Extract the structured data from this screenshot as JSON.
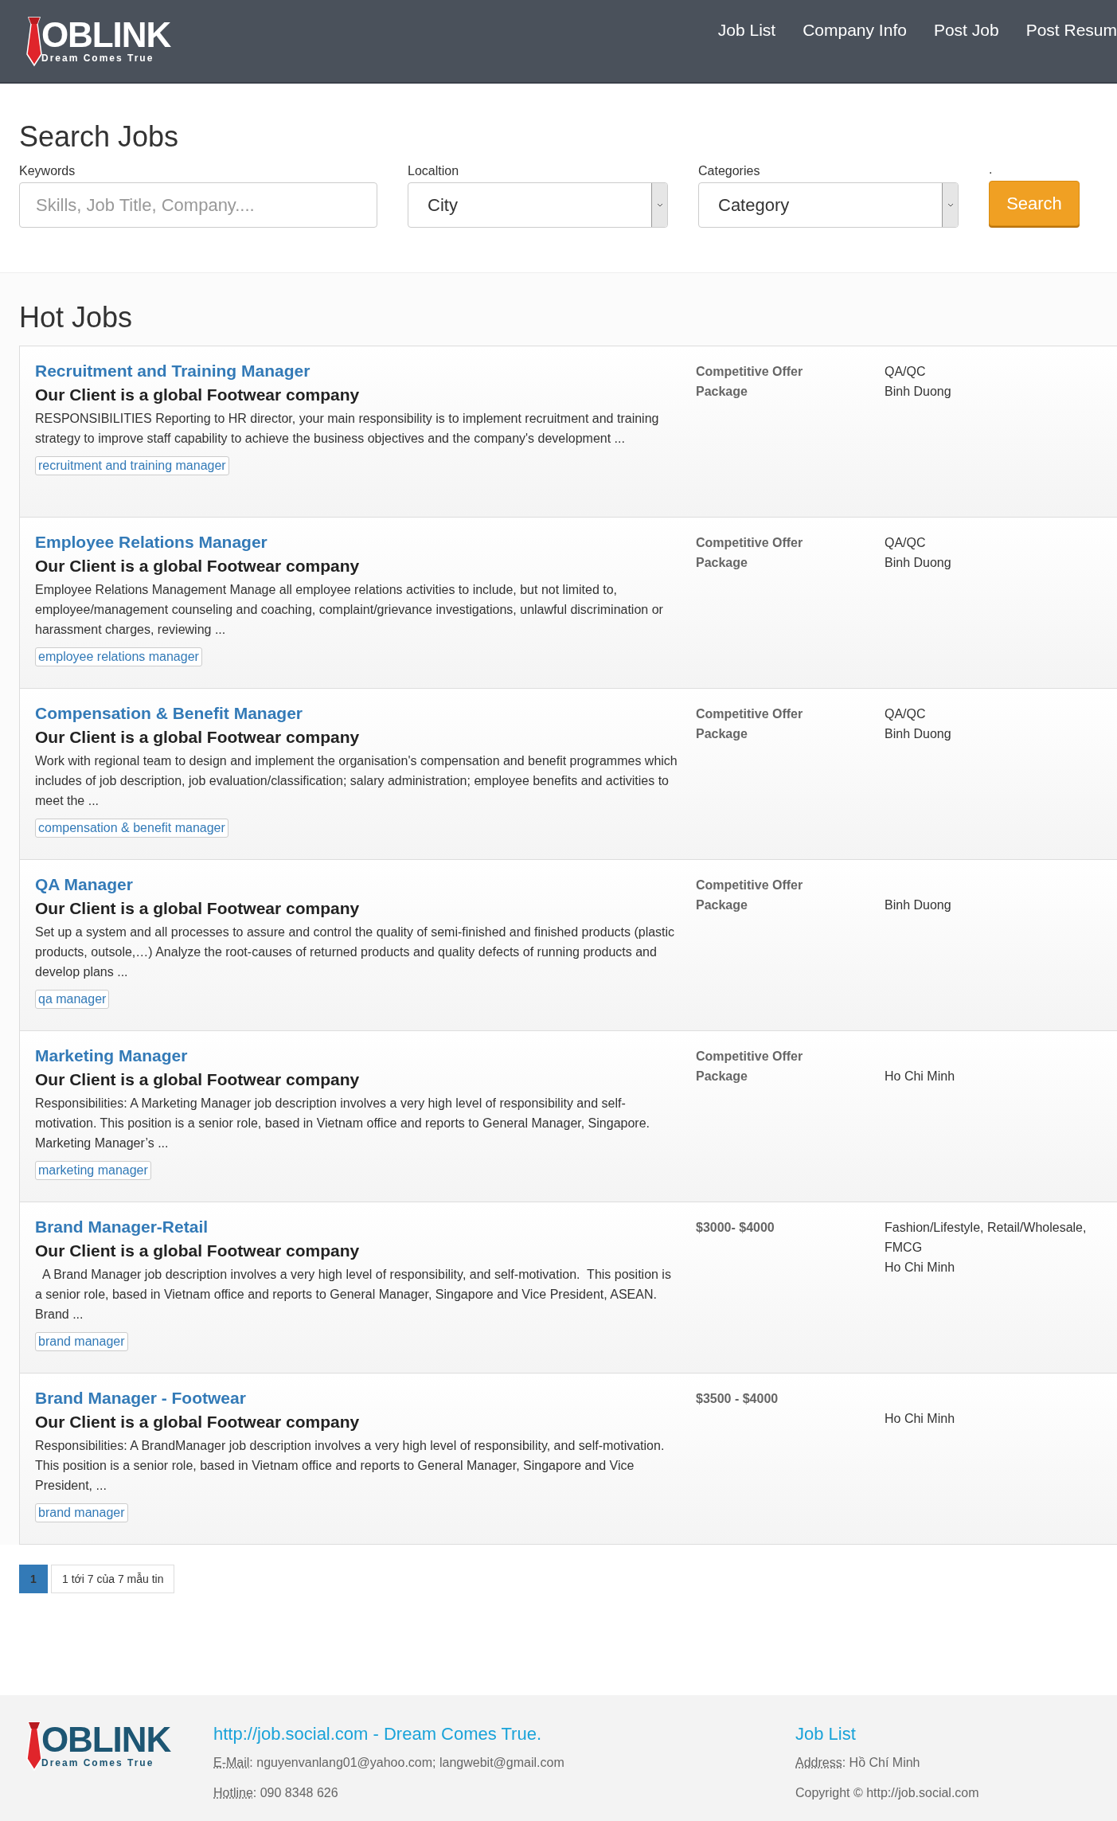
{
  "header": {
    "logo": {
      "name": "OBLINK",
      "tagline": "Dream Comes True"
    },
    "nav": [
      {
        "label": "Job List"
      },
      {
        "label": "Company Info"
      },
      {
        "label": "Post Job"
      },
      {
        "label": "Post Resum"
      }
    ]
  },
  "search": {
    "title": "Search Jobs",
    "fields": [
      {
        "kind": "text",
        "label": "Keywords",
        "placeholder": "Skills, Job Title, Company...."
      },
      {
        "kind": "select",
        "label": "Localtion",
        "value": "City"
      },
      {
        "kind": "select",
        "label": "Categories",
        "value": "Category"
      }
    ],
    "button_label": ".",
    "button": "Search"
  },
  "hot_jobs": {
    "title": "Hot Jobs",
    "jobs": [
      {
        "title": "Recruitment and Training Manager",
        "company": "Our Client is a global Footwear company",
        "description": "RESPONSIBILITIES Reporting to HR director, your main responsibility is to implement recruitment and training strategy to improve staff capability to achieve the business objectives and the company's development ...",
        "tag": "recruitment and training manager",
        "salary": "Competitive Offer Package",
        "category": "QA/QC",
        "location": "Binh Duong"
      },
      {
        "title": "Employee Relations Manager",
        "company": "Our Client is a global Footwear company",
        "description": "Employee Relations Management Manage all employee relations activities to include, but not limited to, employee/management counseling and coaching, complaint/grievance investigations, unlawful discrimination or harassment charges, reviewing ...",
        "tag": "employee relations manager",
        "salary": "Competitive Offer Package",
        "category": "QA/QC",
        "location": "Binh Duong"
      },
      {
        "title": "Compensation & Benefit Manager",
        "company": "Our Client is a global Footwear company",
        "description": "Work with regional team to design and implement the organisation's compensation and benefit programmes which includes of job description, job evaluation/classification; salary administration; employee benefits and activities to meet the ...",
        "tag": "compensation & benefit manager",
        "salary": "Competitive Offer Package",
        "category": "QA/QC",
        "location": "Binh Duong"
      },
      {
        "title": "QA Manager",
        "company": "Our Client is a global Footwear company",
        "description": "Set up a system and all processes to assure and control the quality of semi-finished and finished products (plastic products, outsole,…) Analyze the root-causes of returned products and quality defects of running products and develop plans ...",
        "tag": "qa manager",
        "salary": "Competitive Offer Package",
        "location": "Binh Duong"
      },
      {
        "title": "Marketing Manager",
        "company": "Our Client is a global Footwear company",
        "description": "Responsibilities: A Marketing Manager job description involves a very high level of responsibility and self-motivation. This position is a senior role, based in Vietnam office and reports to General Manager, Singapore. Marketing Manager’s ...",
        "tag": "marketing manager",
        "salary": "Competitive Offer Package",
        "location": "Ho Chi Minh"
      },
      {
        "title": "Brand Manager-Retail",
        "company": "Our Client is a global Footwear company",
        "description": "  A Brand Manager job description involves a very high level of responsibility, and self-motivation.  This position is a senior role, based in Vietnam office and reports to General Manager, Singapore and Vice President, ASEAN.    Brand ...",
        "tag": "brand manager",
        "salary": "$3000- $4000",
        "category": "Fashion/Lifestyle, Retail/Wholesale, FMCG",
        "location": "Ho Chi Minh"
      },
      {
        "title": "Brand Manager - Footwear",
        "company": "Our Client is a global Footwear company",
        "description": "Responsibilities: A BrandManager job description involves a very high level of responsibility, and self-motivation.  This position is a senior role, based in Vietnam office and reports to General Manager, Singapore and Vice President, ...",
        "tag": "brand manager",
        "salary": "$3500 - $4000",
        "location": "Ho Chi Minh"
      }
    ]
  },
  "pagination": {
    "pages": [
      {
        "label": "1",
        "selected": true
      }
    ],
    "info": "1 tới 7 của 7 mẫu tin"
  },
  "footer": {
    "logo": {
      "name": "OBLINK",
      "tagline": "Dream Comes True"
    },
    "site_link": "http://job.social.com - Dream Comes True.",
    "email": {
      "label": "E-Mail",
      "value": ": nguyenvanlang01@yahoo.com; langwebit@gmail.com"
    },
    "hotline": {
      "label": "Hotline",
      "value": ": 090 8348 626"
    },
    "job_list_link": "Job List",
    "address": {
      "label": "Address",
      "value": ": Hồ Chí Minh"
    },
    "copyright": "Copyright © http://job.social.com"
  }
}
